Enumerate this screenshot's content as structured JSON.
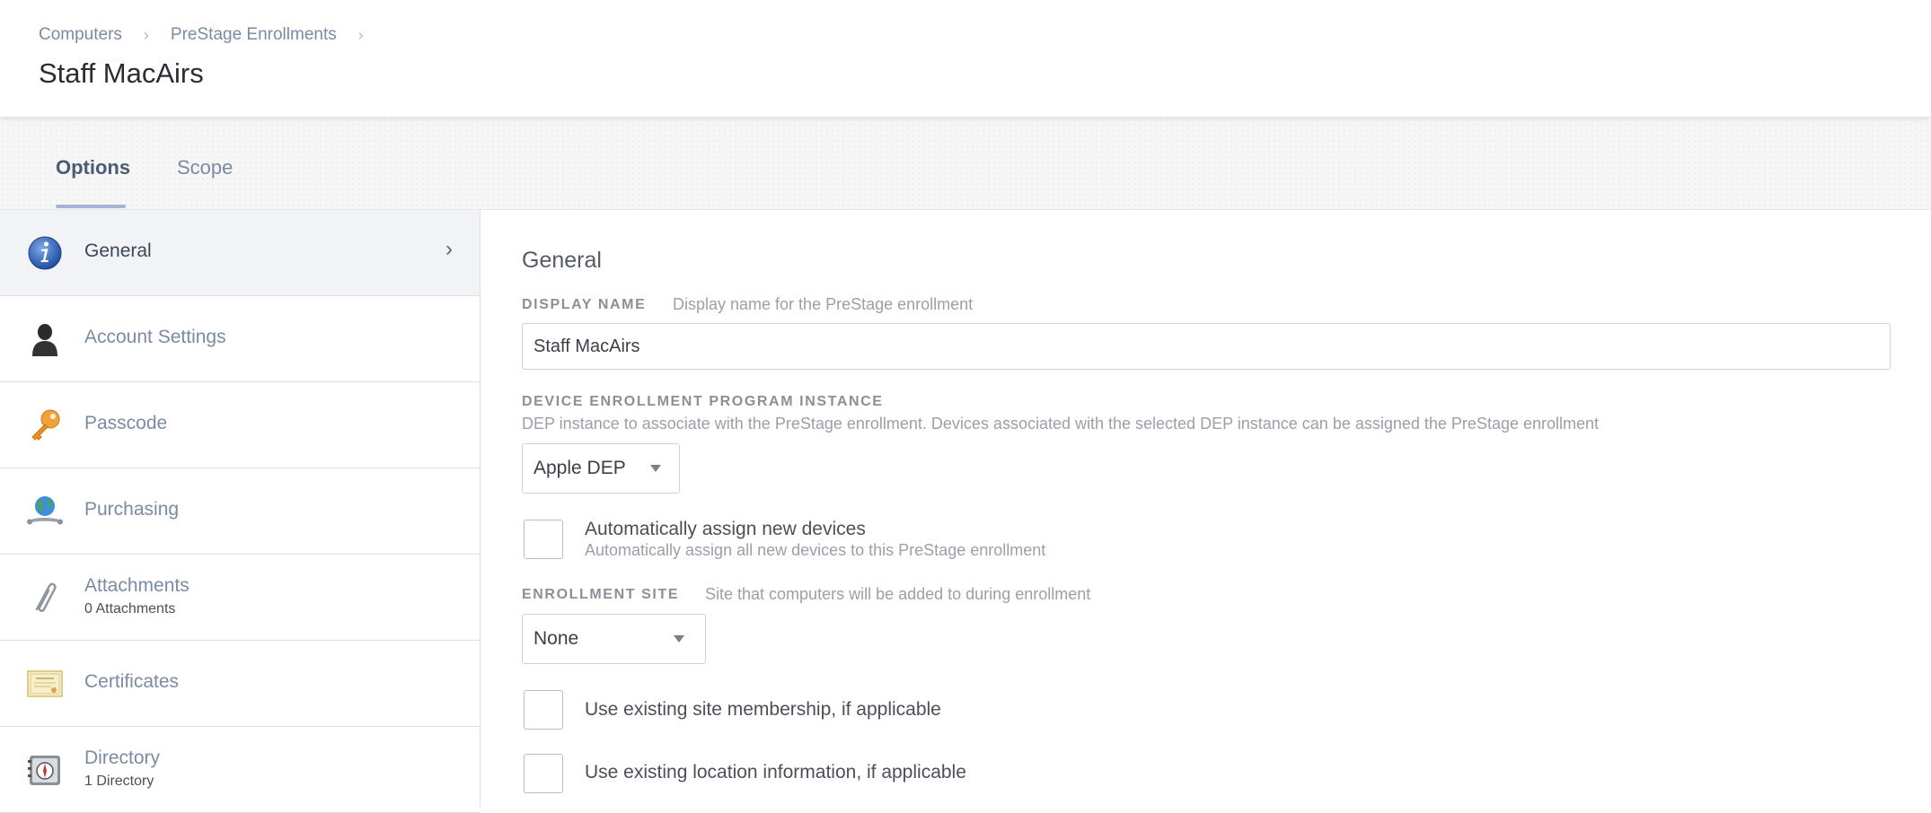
{
  "breadcrumb": {
    "items": [
      "Computers",
      "PreStage Enrollments"
    ],
    "separator": "›"
  },
  "page_title": "Staff MacAirs",
  "tabs": [
    {
      "label": "Options",
      "active": true
    },
    {
      "label": "Scope",
      "active": false
    }
  ],
  "sidebar": {
    "items": [
      {
        "label": "General",
        "sub": "",
        "icon": "info-icon",
        "active": true
      },
      {
        "label": "Account Settings",
        "sub": "",
        "icon": "user-silhouette-icon",
        "active": false
      },
      {
        "label": "Passcode",
        "sub": "",
        "icon": "key-icon",
        "active": false
      },
      {
        "label": "Purchasing",
        "sub": "",
        "icon": "globe-icon",
        "active": false
      },
      {
        "label": "Attachments",
        "sub": "0 Attachments",
        "icon": "paperclip-icon",
        "active": false
      },
      {
        "label": "Certificates",
        "sub": "",
        "icon": "certificate-icon",
        "active": false
      },
      {
        "label": "Directory",
        "sub": "1 Directory",
        "icon": "directory-icon",
        "active": false
      }
    ],
    "chevron": "›"
  },
  "main": {
    "section_title": "General",
    "display_name": {
      "label": "DISPLAY NAME",
      "help": "Display name for the PreStage enrollment",
      "value": "Staff MacAirs"
    },
    "dep_instance": {
      "label": "DEVICE ENROLLMENT PROGRAM INSTANCE",
      "help": "DEP instance to associate with the PreStage enrollment. Devices associated with the selected DEP instance can be assigned the PreStage enrollment",
      "value": "Apple DEP"
    },
    "auto_assign": {
      "label": "Automatically assign new devices",
      "help": "Automatically assign all new devices to this PreStage enrollment",
      "checked": false
    },
    "enrollment_site": {
      "label": "ENROLLMENT SITE",
      "help": "Site that computers will be added to during enrollment",
      "value": "None"
    },
    "site_membership": {
      "label": "Use existing site membership, if applicable",
      "checked": false
    },
    "location_info": {
      "label": "Use existing location information, if applicable",
      "checked": false
    }
  },
  "colors": {
    "accent": "#a6b4d8",
    "link": "#7a8ba3",
    "text": "#2a2d33"
  }
}
